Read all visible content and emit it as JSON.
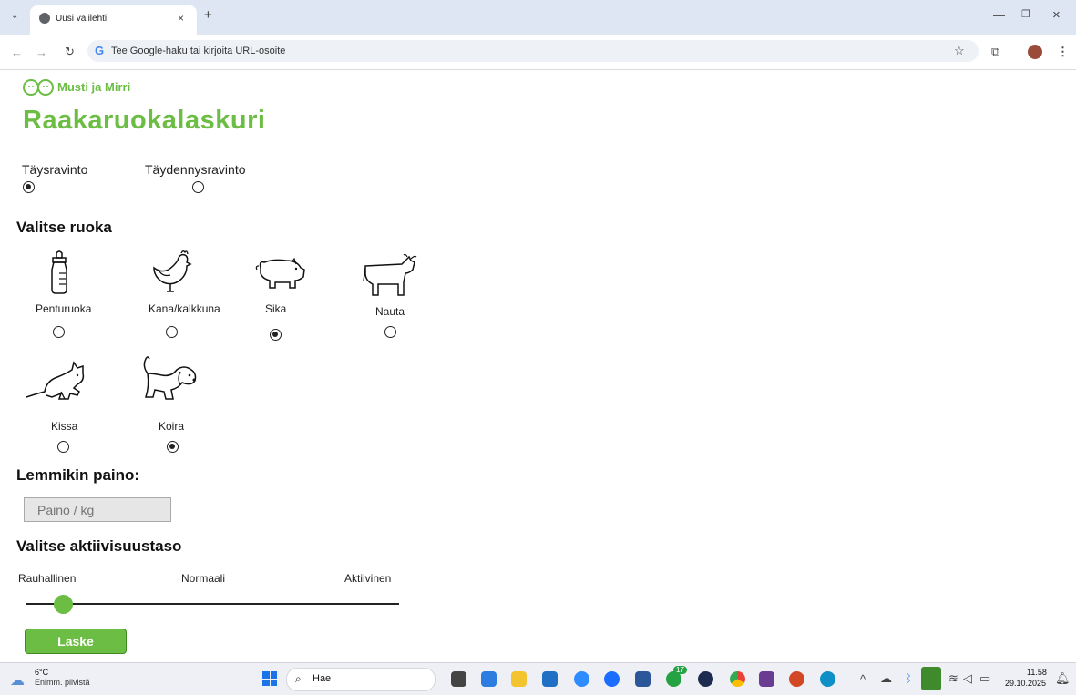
{
  "browser": {
    "tab_title": "Uusi välilehti",
    "omnibox_placeholder": "Tee Google-haku tai kirjoita URL-osoite"
  },
  "page": {
    "logo_text": "Musti ja Mirri",
    "title": "Raakaruokalaskuri",
    "diet_options": [
      {
        "label": "Täysravinto",
        "selected": true
      },
      {
        "label": "Täydennysravinto",
        "selected": false
      }
    ],
    "food_heading": "Valitse ruoka",
    "foods": [
      {
        "label": "Penturuoka",
        "icon": "baby-bottle-icon",
        "selected": false
      },
      {
        "label": "Kana/kalkkuna",
        "icon": "chicken-icon",
        "selected": false
      },
      {
        "label": "Sika",
        "icon": "pig-icon",
        "selected": true
      },
      {
        "label": "Nauta",
        "icon": "cow-icon",
        "selected": false
      },
      {
        "label": "Kissa",
        "icon": "cat-icon",
        "selected": false
      },
      {
        "label": "Koira",
        "icon": "dog-icon",
        "selected": true
      }
    ],
    "weight_heading": "Lemmikin paino:",
    "weight_placeholder": "Paino / kg",
    "activity_heading": "Valitse aktiivisuustaso",
    "activity_labels": [
      "Rauhallinen",
      "Normaali",
      "Aktiivinen"
    ],
    "activity_value": 0.1,
    "calc_button": "Laske",
    "accent_color": "#6cbd44"
  },
  "taskbar": {
    "weather_temp": "6°C",
    "weather_desc": "Enimm. pilvistä",
    "search_label": "Hae",
    "chat_badge": "17",
    "clock_time": "11.58",
    "clock_date": "29.10.2025"
  }
}
